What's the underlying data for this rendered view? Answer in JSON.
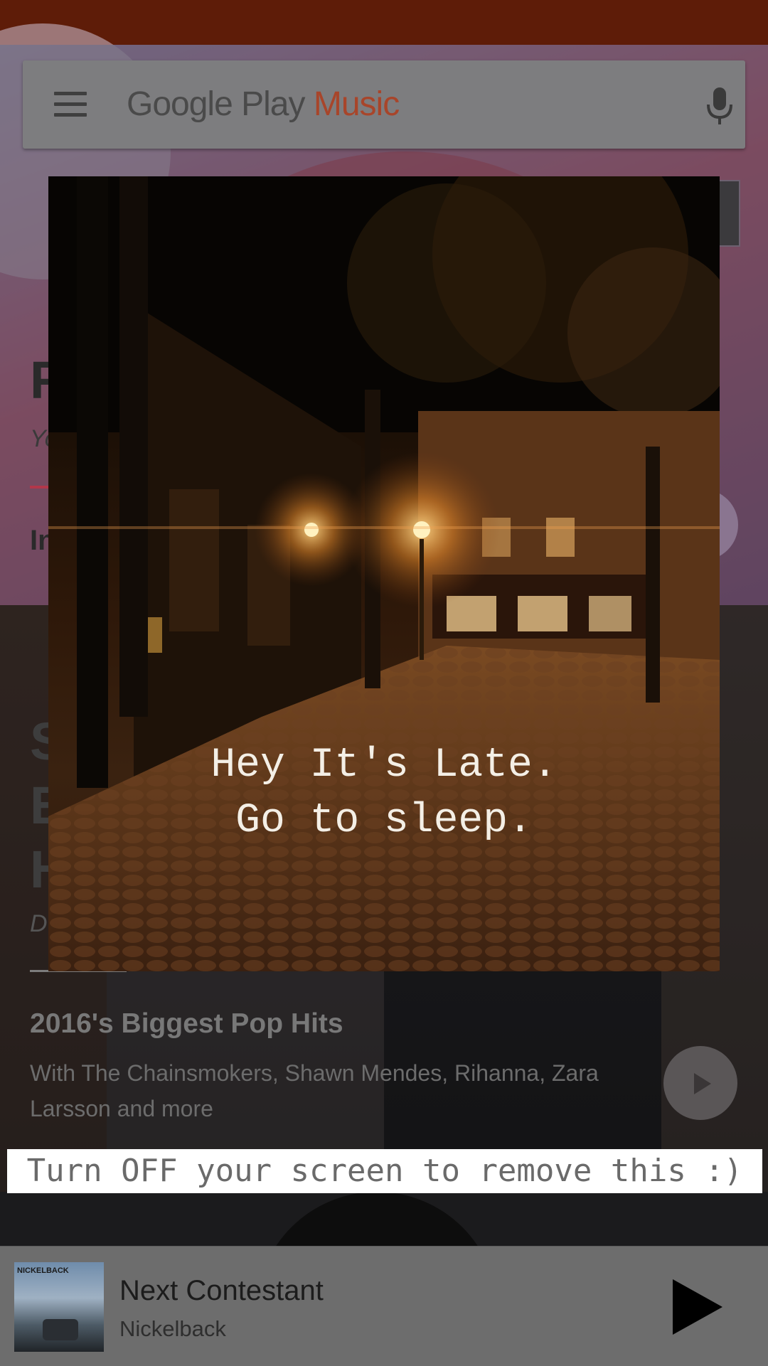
{
  "app": {
    "logo_prefix": "Google Play",
    "logo_suffix": "Music"
  },
  "background_peek": {
    "headline_letter": "F",
    "subtitle_letters": "Yo",
    "section_letters": "In",
    "hero_letters": [
      "S",
      "E",
      "H"
    ],
    "credit_letters": "D"
  },
  "shelf": {
    "title": "2016's Biggest Pop Hits",
    "subtitle": "With The Chainsmokers, Shawn Mendes, Rihanna, Zara Larsson and more"
  },
  "overlay": {
    "line1": "Hey It's Late.",
    "line2": "Go to sleep."
  },
  "banner": {
    "text": "Turn OFF your screen to remove this :)"
  },
  "now_playing": {
    "title": "Next Contestant",
    "artist": "Nickelback",
    "album_band_text": "NICKELBACK"
  },
  "colors": {
    "status_bar": "#5e1c08",
    "logo_accent": "#a8452a",
    "player_bg": "#6d6d6d"
  },
  "icons": [
    "hamburger-icon",
    "mic-icon",
    "play-icon"
  ]
}
